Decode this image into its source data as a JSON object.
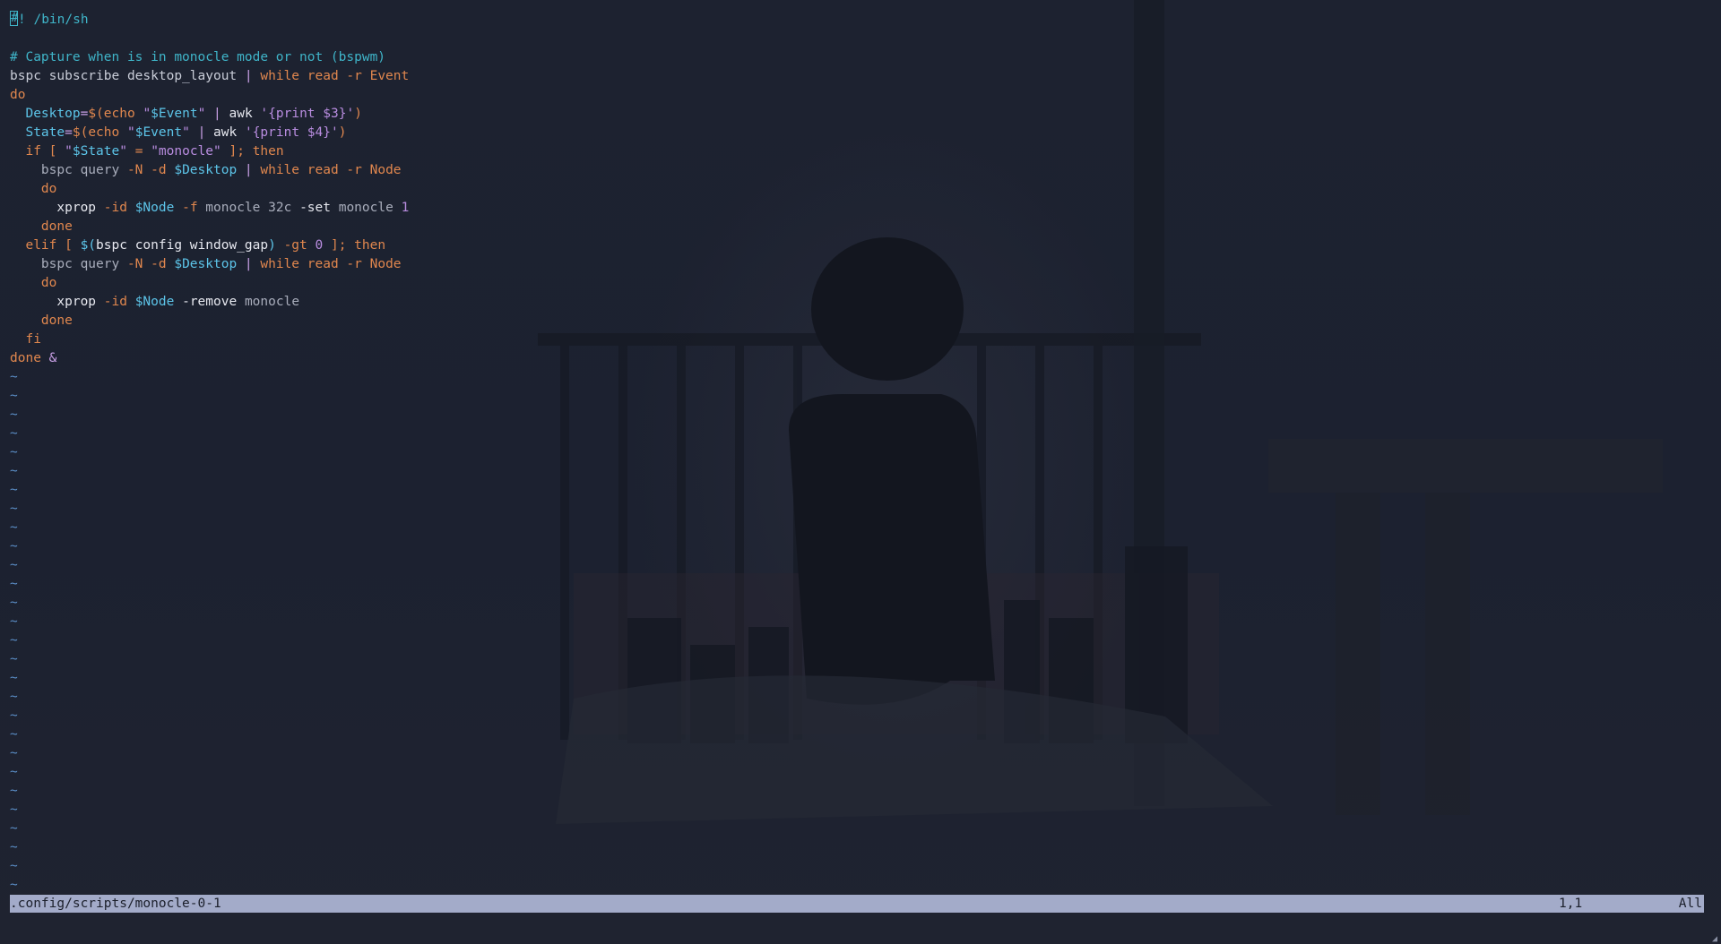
{
  "editor": {
    "cursor_char": "#",
    "lines": [
      {
        "segs": [
          [
            "t-shebang",
            "! /bin/sh"
          ]
        ],
        "cursor": true
      },
      {
        "segs": []
      },
      {
        "segs": [
          [
            "t-comment",
            "# Capture when is in monocle mode or not (bspwm)"
          ]
        ]
      },
      {
        "segs": [
          [
            "t-cmd",
            "bspc subscribe desktop_layout "
          ],
          [
            "t-op",
            "| "
          ],
          [
            "t-keyword",
            "while read -r Event"
          ]
        ]
      },
      {
        "segs": [
          [
            "t-keyword",
            "do"
          ]
        ]
      },
      {
        "segs": [
          [
            "t-plain",
            "  "
          ],
          [
            "t-var",
            "Desktop"
          ],
          [
            "t-op",
            "="
          ],
          [
            "t-keyword",
            "$("
          ],
          [
            "t-keyword",
            "echo "
          ],
          [
            "t-string",
            "\""
          ],
          [
            "t-var",
            "$Event"
          ],
          [
            "t-string",
            "\" "
          ],
          [
            "t-op",
            "| "
          ],
          [
            "t-bright",
            "awk "
          ],
          [
            "t-string",
            "'{print $3}'"
          ],
          [
            "t-keyword",
            ")"
          ]
        ]
      },
      {
        "segs": [
          [
            "t-plain",
            "  "
          ],
          [
            "t-var",
            "State"
          ],
          [
            "t-op",
            "="
          ],
          [
            "t-keyword",
            "$("
          ],
          [
            "t-keyword",
            "echo "
          ],
          [
            "t-string",
            "\""
          ],
          [
            "t-var",
            "$Event"
          ],
          [
            "t-string",
            "\" "
          ],
          [
            "t-op",
            "| "
          ],
          [
            "t-bright",
            "awk "
          ],
          [
            "t-string",
            "'{print $4}'"
          ],
          [
            "t-keyword",
            ")"
          ]
        ]
      },
      {
        "segs": [
          [
            "t-plain",
            "  "
          ],
          [
            "t-keyword",
            "if [ "
          ],
          [
            "t-string",
            "\""
          ],
          [
            "t-var",
            "$State"
          ],
          [
            "t-string",
            "\" "
          ],
          [
            "t-keyword",
            "= "
          ],
          [
            "t-string",
            "\"monocle\" "
          ],
          [
            "t-keyword",
            "]; then"
          ]
        ]
      },
      {
        "segs": [
          [
            "t-plain",
            "    bspc query "
          ],
          [
            "t-flag",
            "-N -d "
          ],
          [
            "t-var",
            "$Desktop "
          ],
          [
            "t-op",
            "| "
          ],
          [
            "t-keyword",
            "while read -r Node"
          ]
        ]
      },
      {
        "segs": [
          [
            "t-plain",
            "    "
          ],
          [
            "t-keyword",
            "do"
          ]
        ]
      },
      {
        "segs": [
          [
            "t-plain",
            "      "
          ],
          [
            "t-bright",
            "xprop "
          ],
          [
            "t-flag",
            "-id "
          ],
          [
            "t-var",
            "$Node "
          ],
          [
            "t-flag",
            "-f "
          ],
          [
            "t-plain",
            "monocle 32c "
          ],
          [
            "t-bright",
            "-set "
          ],
          [
            "t-plain",
            "monocle "
          ],
          [
            "t-num",
            "1"
          ]
        ]
      },
      {
        "segs": [
          [
            "t-plain",
            "    "
          ],
          [
            "t-keyword",
            "done"
          ]
        ]
      },
      {
        "segs": [
          [
            "t-plain",
            "  "
          ],
          [
            "t-keyword",
            "elif [ "
          ],
          [
            "t-var",
            "$("
          ],
          [
            "t-bright",
            "bspc config window_gap"
          ],
          [
            "t-var",
            ")"
          ],
          [
            "t-flag",
            " -gt "
          ],
          [
            "t-num",
            "0 "
          ],
          [
            "t-keyword",
            "]; then"
          ]
        ]
      },
      {
        "segs": [
          [
            "t-plain",
            "    bspc query "
          ],
          [
            "t-flag",
            "-N -d "
          ],
          [
            "t-var",
            "$Desktop "
          ],
          [
            "t-op",
            "| "
          ],
          [
            "t-keyword",
            "while read -r Node"
          ]
        ]
      },
      {
        "segs": [
          [
            "t-plain",
            "    "
          ],
          [
            "t-keyword",
            "do"
          ]
        ]
      },
      {
        "segs": [
          [
            "t-plain",
            "      "
          ],
          [
            "t-bright",
            "xprop "
          ],
          [
            "t-flag",
            "-id "
          ],
          [
            "t-var",
            "$Node "
          ],
          [
            "t-bright",
            "-remove "
          ],
          [
            "t-plain",
            "monocle"
          ]
        ]
      },
      {
        "segs": [
          [
            "t-plain",
            "    "
          ],
          [
            "t-keyword",
            "done"
          ]
        ]
      },
      {
        "segs": [
          [
            "t-plain",
            "  "
          ],
          [
            "t-keyword",
            "fi"
          ]
        ]
      },
      {
        "segs": [
          [
            "t-keyword",
            "done "
          ],
          [
            "t-op",
            "&"
          ]
        ]
      }
    ],
    "tilde_count": 28,
    "tilde_char": "~"
  },
  "statusline": {
    "filename": ".config/scripts/monocle-0-1",
    "position": "1,1",
    "scroll": "All"
  },
  "cmdline": "",
  "resize_glyph": "◢",
  "colors": {
    "background": "#1b1f2b",
    "comment": "#3fb4c8",
    "keyword": "#e0874e",
    "variable": "#5cc4e8",
    "string": "#b98de0",
    "statusline_bg": "#a3abc9",
    "tilde": "#5b8ec7"
  }
}
